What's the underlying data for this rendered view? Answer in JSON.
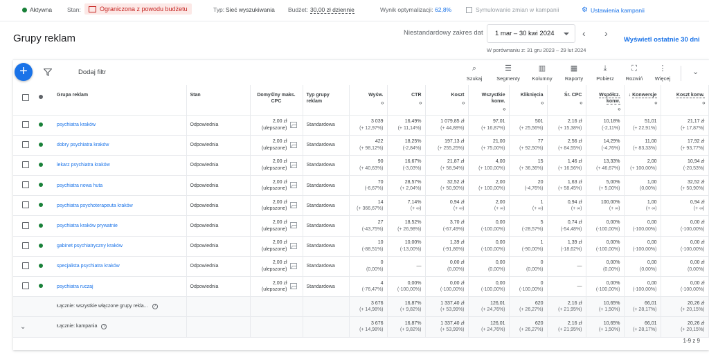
{
  "topbar": {
    "status": "Aktywna",
    "stan_label": "Stan:",
    "stan_value": "Ograniczona z powodu budżetu",
    "type_label": "Typ:",
    "type_value": "Sieć wyszukiwania",
    "budget_label": "Budżet:",
    "budget_value": "30,00 zł dziennie",
    "opt_label": "Wynik optymalizacji:",
    "opt_value": "62,8%",
    "simulate": "Symulowanie zmian w kampanii",
    "settings": "Ustawienia kampanii"
  },
  "header": {
    "title": "Grupy reklam",
    "range_label": "Niestandardowy zakres dat",
    "date_range": "1 mar – 30 kwi 2024",
    "comparison": "W porównaniu z: 31 gru 2023 – 29 lut 2024",
    "last30": "Wyświetl ostatnie 30 dni"
  },
  "toolbar": {
    "add_filter": "Dodaj filtr",
    "tools": [
      {
        "icon": "search-icon",
        "label": "Szukaj"
      },
      {
        "icon": "segments-icon",
        "label": "Segmenty"
      },
      {
        "icon": "columns-icon",
        "label": "Kolumny"
      },
      {
        "icon": "reports-icon",
        "label": "Raporty"
      },
      {
        "icon": "download-icon",
        "label": "Pobierz"
      },
      {
        "icon": "expand-icon",
        "label": "Rozwiń"
      },
      {
        "icon": "more-icon",
        "label": "Więcej"
      }
    ]
  },
  "table": {
    "columns": {
      "name": "Grupa reklam",
      "status": "Stan",
      "cpc_default": "Domyślny maks. CPC",
      "type": "Typ grupy reklam",
      "impr": "Wyśw.",
      "ctr": "CTR",
      "cost": "Koszt",
      "allconv": "Wszystkie konw.",
      "clicks": "Kliknięcia",
      "avgcpc": "Śr. CPC",
      "convrate": "Współcz. konw.",
      "conv": "Konwersje",
      "costconv": "Koszt konw."
    },
    "rows": [
      {
        "name": "psychiatra kraków",
        "status": "Odpowiednia",
        "cpc": "2,00 zł",
        "cpc_note": "(ulepszone)",
        "type": "Standardowa",
        "impr": "3 039",
        "impr_c": "(+ 12,97%)",
        "ctr": "16,49%",
        "ctr_c": "(+ 11,14%)",
        "cost": "1 079,85 zł",
        "cost_c": "(+ 44,88%)",
        "allconv": "97,01",
        "allconv_c": "(+ 16,87%)",
        "clicks": "501",
        "clicks_c": "(+ 25,56%)",
        "avgcpc": "2,16 zł",
        "avgcpc_c": "(+ 15,38%)",
        "convrate": "10,18%",
        "convrate_c": "(-2,11%)",
        "conv": "51,01",
        "conv_c": "(+ 22,91%)",
        "costconv": "21,17 zł",
        "costconv_c": "(+ 17,87%)"
      },
      {
        "name": "dobry psychiatra kraków",
        "status": "Odpowiednia",
        "cpc": "2,00 zł",
        "cpc_note": "(ulepszone)",
        "type": "Standardowa",
        "impr": "422",
        "impr_c": "(+ 98,12%)",
        "ctr": "18,25%",
        "ctr_c": "(-2,84%)",
        "cost": "197,13 zł",
        "cost_c": "(+ 255,25%)",
        "allconv": "21,00",
        "allconv_c": "(+ 75,00%)",
        "clicks": "77",
        "clicks_c": "(+ 92,50%)",
        "avgcpc": "2,56 zł",
        "avgcpc_c": "(+ 84,55%)",
        "convrate": "14,29%",
        "convrate_c": "(-4,76%)",
        "conv": "11,00",
        "conv_c": "(+ 83,33%)",
        "costconv": "17,92 zł",
        "costconv_c": "(+ 93,77%)"
      },
      {
        "name": "lekarz psychiatra kraków",
        "status": "Odpowiednia",
        "cpc": "2,00 zł",
        "cpc_note": "(ulepszone)",
        "type": "Standardowa",
        "impr": "90",
        "impr_c": "(+ 40,63%)",
        "ctr": "16,67%",
        "ctr_c": "(-3,03%)",
        "cost": "21,87 zł",
        "cost_c": "(+ 58,94%)",
        "allconv": "4,00",
        "allconv_c": "(+ 100,00%)",
        "clicks": "15",
        "clicks_c": "(+ 36,36%)",
        "avgcpc": "1,46 zł",
        "avgcpc_c": "(+ 16,56%)",
        "convrate": "13,33%",
        "convrate_c": "(+ 46,67%)",
        "conv": "2,00",
        "conv_c": "(+ 100,00%)",
        "costconv": "10,94 zł",
        "costconv_c": "(-20,53%)"
      },
      {
        "name": "psychiatra nowa huta",
        "status": "Odpowiednia",
        "cpc": "2,00 zł",
        "cpc_note": "(ulepszone)",
        "type": "Standardowa",
        "impr": "70",
        "impr_c": "(-6,67%)",
        "ctr": "28,57%",
        "ctr_c": "(+ 2,04%)",
        "cost": "32,52 zł",
        "cost_c": "(+ 50,90%)",
        "allconv": "2,00",
        "allconv_c": "(+ 100,00%)",
        "clicks": "20",
        "clicks_c": "(-4,76%)",
        "avgcpc": "1,63 zł",
        "avgcpc_c": "(+ 58,45%)",
        "convrate": "5,00%",
        "convrate_c": "(+ 5,00%)",
        "conv": "1,00",
        "conv_c": "(0,00%)",
        "costconv": "32,52 zł",
        "costconv_c": "(+ 50,90%)"
      },
      {
        "name": "psychiatra psychoterapeuta kraków",
        "status": "Odpowiednia",
        "cpc": "2,00 zł",
        "cpc_note": "(ulepszone)",
        "type": "Standardowa",
        "impr": "14",
        "impr_c": "(+ 366,67%)",
        "ctr": "7,14%",
        "ctr_c": "(+ ∞)",
        "cost": "0,94 zł",
        "cost_c": "(+ ∞)",
        "allconv": "2,00",
        "allconv_c": "(+ ∞)",
        "clicks": "1",
        "clicks_c": "(+ ∞)",
        "avgcpc": "0,94 zł",
        "avgcpc_c": "(+ ∞)",
        "convrate": "100,00%",
        "convrate_c": "(+ ∞)",
        "conv": "1,00",
        "conv_c": "(+ ∞)",
        "costconv": "0,94 zł",
        "costconv_c": "(+ ∞)"
      },
      {
        "name": "psychiatra kraków prywatnie",
        "status": "Odpowiednia",
        "cpc": "2,00 zł",
        "cpc_note": "(ulepszone)",
        "type": "Standardowa",
        "impr": "27",
        "impr_c": "(-43,75%)",
        "ctr": "18,52%",
        "ctr_c": "(+ 26,98%)",
        "cost": "3,70 zł",
        "cost_c": "(-67,49%)",
        "allconv": "0,00",
        "allconv_c": "(-100,00%)",
        "clicks": "5",
        "clicks_c": "(-28,57%)",
        "avgcpc": "0,74 zł",
        "avgcpc_c": "(-54,48%)",
        "convrate": "0,00%",
        "convrate_c": "(-100,00%)",
        "conv": "0,00",
        "conv_c": "(-100,00%)",
        "costconv": "0,00 zł",
        "costconv_c": "(-100,00%)"
      },
      {
        "name": "gabinet psychiatryczny kraków",
        "status": "Odpowiednia",
        "cpc": "2,00 zł",
        "cpc_note": "(ulepszone)",
        "type": "Standardowa",
        "impr": "10",
        "impr_c": "(-88,51%)",
        "ctr": "10,00%",
        "ctr_c": "(-13,00%)",
        "cost": "1,39 zł",
        "cost_c": "(-91,86%)",
        "allconv": "0,00",
        "allconv_c": "(-100,00%)",
        "clicks": "1",
        "clicks_c": "(-90,00%)",
        "avgcpc": "1,39 zł",
        "avgcpc_c": "(-18,62%)",
        "convrate": "0,00%",
        "convrate_c": "(-100,00%)",
        "conv": "0,00",
        "conv_c": "(-100,00%)",
        "costconv": "0,00 zł",
        "costconv_c": "(-100,00%)"
      },
      {
        "name": "specjalista psychiatra kraków",
        "status": "Odpowiednia",
        "cpc": "2,00 zł",
        "cpc_note": "(ulepszone)",
        "type": "Standardowa",
        "impr": "0",
        "impr_c": "(0,00%)",
        "ctr": "—",
        "ctr_c": "",
        "cost": "0,00 zł",
        "cost_c": "(0,00%)",
        "allconv": "0,00",
        "allconv_c": "(0,00%)",
        "clicks": "0",
        "clicks_c": "(0,00%)",
        "avgcpc": "—",
        "avgcpc_c": "",
        "convrate": "0,00%",
        "convrate_c": "(0,00%)",
        "conv": "0,00",
        "conv_c": "(0,00%)",
        "costconv": "0,00 zł",
        "costconv_c": "(0,00%)"
      },
      {
        "name": "psychiatra ruczaj",
        "status": "Odpowiednia",
        "cpc": "2,00 zł",
        "cpc_note": "(ulepszone)",
        "type": "Standardowa",
        "impr": "4",
        "impr_c": "(-76,47%)",
        "ctr": "0,00%",
        "ctr_c": "(-100,00%)",
        "cost": "0,00 zł",
        "cost_c": "(-100,00%)",
        "allconv": "0,00",
        "allconv_c": "(-100,00%)",
        "clicks": "0",
        "clicks_c": "(-100,00%)",
        "avgcpc": "—",
        "avgcpc_c": "",
        "convrate": "0,00%",
        "convrate_c": "(-100,00%)",
        "conv": "0,00",
        "conv_c": "(-100,00%)",
        "costconv": "0,00 zł",
        "costconv_c": "(-100,00%)"
      }
    ],
    "totals": [
      {
        "label": "Łącznie: wszystkie włączone grupy rekla...",
        "impr": "3 676",
        "impr_c": "(+ 14,98%)",
        "ctr": "16,87%",
        "ctr_c": "(+ 9,82%)",
        "cost": "1 337,40 zł",
        "cost_c": "(+ 53,99%)",
        "allconv": "126,01",
        "allconv_c": "(+ 24,76%)",
        "clicks": "620",
        "clicks_c": "(+ 26,27%)",
        "avgcpc": "2,16 zł",
        "avgcpc_c": "(+ 21,95%)",
        "convrate": "10,65%",
        "convrate_c": "(+ 1,50%)",
        "conv": "66,01",
        "conv_c": "(+ 28,17%)",
        "costconv": "20,26 zł",
        "costconv_c": "(+ 20,15%)"
      },
      {
        "label": "Łącznie: kampania",
        "impr": "3 676",
        "impr_c": "(+ 14,98%)",
        "ctr": "16,87%",
        "ctr_c": "(+ 9,82%)",
        "cost": "1 337,40 zł",
        "cost_c": "(+ 53,99%)",
        "allconv": "126,01",
        "allconv_c": "(+ 24,76%)",
        "clicks": "620",
        "clicks_c": "(+ 26,27%)",
        "avgcpc": "2,16 zł",
        "avgcpc_c": "(+ 21,95%)",
        "convrate": "10,65%",
        "convrate_c": "(+ 1,50%)",
        "conv": "66,01",
        "conv_c": "(+ 28,17%)",
        "costconv": "20,26 zł",
        "costconv_c": "(+ 20,15%)"
      }
    ],
    "pagination": "1-9 z 9"
  },
  "colors": {
    "accent": "#1a73e8",
    "active": "#188038",
    "limited_bg": "#fce8e6",
    "limited_text": "#c5221f"
  }
}
